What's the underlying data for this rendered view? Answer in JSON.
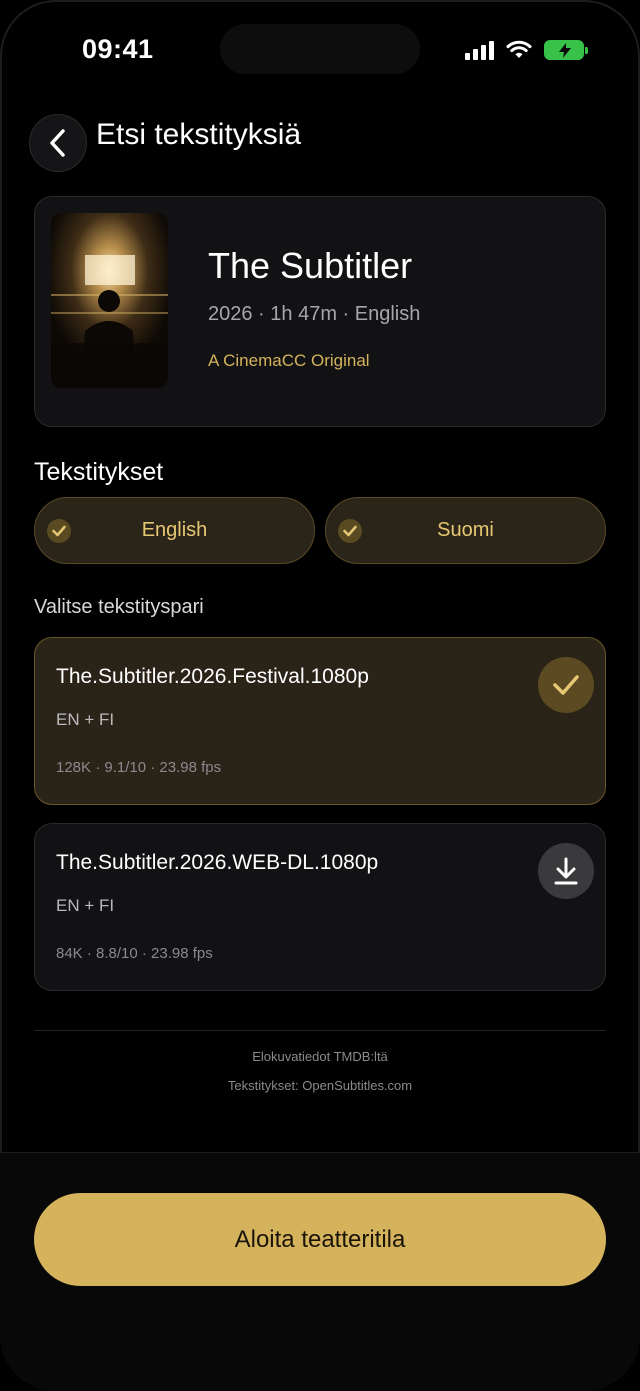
{
  "status_bar": {
    "time": "09:41"
  },
  "header": {
    "title": "Etsi tekstityksiä"
  },
  "movie": {
    "title": "The Subtitler",
    "meta": "2026 · 1h 47m · English",
    "badge": "A CinemaCC Original"
  },
  "subtitles": {
    "section_title": "Tekstitykset",
    "languages": [
      {
        "label": "English",
        "selected": true
      },
      {
        "label": "Suomi",
        "selected": true
      }
    ]
  },
  "pairs": {
    "section_title": "Valitse tekstityspari",
    "items": [
      {
        "name": "The.Subtitler.2026.Festival.1080p",
        "langs": "EN + FI",
        "stats": "128K · 9.1/10 · 23.98 fps",
        "selected": true,
        "icon": "check-icon"
      },
      {
        "name": "The.Subtitler.2026.WEB-DL.1080p",
        "langs": "EN + FI",
        "stats": "84K · 8.8/10 · 23.98 fps",
        "selected": false,
        "icon": "download-icon"
      }
    ]
  },
  "credits": {
    "line1": "Elokuvatiedot TMDB:ltä",
    "line2": "Tekstitykset: OpenSubtitles.com"
  },
  "cta": {
    "label": "Aloita teatteritila"
  },
  "colors": {
    "accent": "#d5b35d",
    "background": "#000000",
    "card": "#121214",
    "selected_card": "#2a2318",
    "battery": "#39c24a"
  }
}
